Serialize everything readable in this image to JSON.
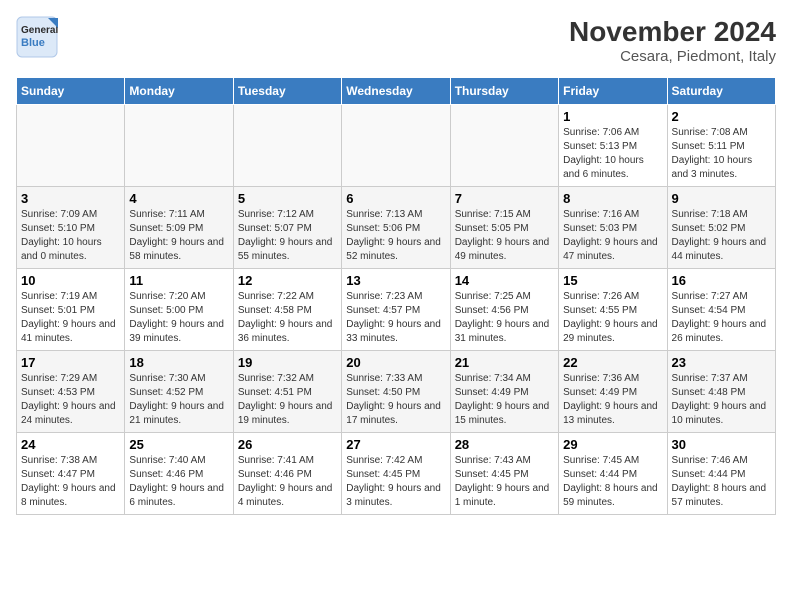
{
  "logo": {
    "line1": "General",
    "line2": "Blue"
  },
  "title": "November 2024",
  "subtitle": "Cesara, Piedmont, Italy",
  "weekdays": [
    "Sunday",
    "Monday",
    "Tuesday",
    "Wednesday",
    "Thursday",
    "Friday",
    "Saturday"
  ],
  "weeks": [
    [
      {
        "day": "",
        "info": ""
      },
      {
        "day": "",
        "info": ""
      },
      {
        "day": "",
        "info": ""
      },
      {
        "day": "",
        "info": ""
      },
      {
        "day": "",
        "info": ""
      },
      {
        "day": "1",
        "info": "Sunrise: 7:06 AM\nSunset: 5:13 PM\nDaylight: 10 hours and 6 minutes."
      },
      {
        "day": "2",
        "info": "Sunrise: 7:08 AM\nSunset: 5:11 PM\nDaylight: 10 hours and 3 minutes."
      }
    ],
    [
      {
        "day": "3",
        "info": "Sunrise: 7:09 AM\nSunset: 5:10 PM\nDaylight: 10 hours and 0 minutes."
      },
      {
        "day": "4",
        "info": "Sunrise: 7:11 AM\nSunset: 5:09 PM\nDaylight: 9 hours and 58 minutes."
      },
      {
        "day": "5",
        "info": "Sunrise: 7:12 AM\nSunset: 5:07 PM\nDaylight: 9 hours and 55 minutes."
      },
      {
        "day": "6",
        "info": "Sunrise: 7:13 AM\nSunset: 5:06 PM\nDaylight: 9 hours and 52 minutes."
      },
      {
        "day": "7",
        "info": "Sunrise: 7:15 AM\nSunset: 5:05 PM\nDaylight: 9 hours and 49 minutes."
      },
      {
        "day": "8",
        "info": "Sunrise: 7:16 AM\nSunset: 5:03 PM\nDaylight: 9 hours and 47 minutes."
      },
      {
        "day": "9",
        "info": "Sunrise: 7:18 AM\nSunset: 5:02 PM\nDaylight: 9 hours and 44 minutes."
      }
    ],
    [
      {
        "day": "10",
        "info": "Sunrise: 7:19 AM\nSunset: 5:01 PM\nDaylight: 9 hours and 41 minutes."
      },
      {
        "day": "11",
        "info": "Sunrise: 7:20 AM\nSunset: 5:00 PM\nDaylight: 9 hours and 39 minutes."
      },
      {
        "day": "12",
        "info": "Sunrise: 7:22 AM\nSunset: 4:58 PM\nDaylight: 9 hours and 36 minutes."
      },
      {
        "day": "13",
        "info": "Sunrise: 7:23 AM\nSunset: 4:57 PM\nDaylight: 9 hours and 33 minutes."
      },
      {
        "day": "14",
        "info": "Sunrise: 7:25 AM\nSunset: 4:56 PM\nDaylight: 9 hours and 31 minutes."
      },
      {
        "day": "15",
        "info": "Sunrise: 7:26 AM\nSunset: 4:55 PM\nDaylight: 9 hours and 29 minutes."
      },
      {
        "day": "16",
        "info": "Sunrise: 7:27 AM\nSunset: 4:54 PM\nDaylight: 9 hours and 26 minutes."
      }
    ],
    [
      {
        "day": "17",
        "info": "Sunrise: 7:29 AM\nSunset: 4:53 PM\nDaylight: 9 hours and 24 minutes."
      },
      {
        "day": "18",
        "info": "Sunrise: 7:30 AM\nSunset: 4:52 PM\nDaylight: 9 hours and 21 minutes."
      },
      {
        "day": "19",
        "info": "Sunrise: 7:32 AM\nSunset: 4:51 PM\nDaylight: 9 hours and 19 minutes."
      },
      {
        "day": "20",
        "info": "Sunrise: 7:33 AM\nSunset: 4:50 PM\nDaylight: 9 hours and 17 minutes."
      },
      {
        "day": "21",
        "info": "Sunrise: 7:34 AM\nSunset: 4:49 PM\nDaylight: 9 hours and 15 minutes."
      },
      {
        "day": "22",
        "info": "Sunrise: 7:36 AM\nSunset: 4:49 PM\nDaylight: 9 hours and 13 minutes."
      },
      {
        "day": "23",
        "info": "Sunrise: 7:37 AM\nSunset: 4:48 PM\nDaylight: 9 hours and 10 minutes."
      }
    ],
    [
      {
        "day": "24",
        "info": "Sunrise: 7:38 AM\nSunset: 4:47 PM\nDaylight: 9 hours and 8 minutes."
      },
      {
        "day": "25",
        "info": "Sunrise: 7:40 AM\nSunset: 4:46 PM\nDaylight: 9 hours and 6 minutes."
      },
      {
        "day": "26",
        "info": "Sunrise: 7:41 AM\nSunset: 4:46 PM\nDaylight: 9 hours and 4 minutes."
      },
      {
        "day": "27",
        "info": "Sunrise: 7:42 AM\nSunset: 4:45 PM\nDaylight: 9 hours and 3 minutes."
      },
      {
        "day": "28",
        "info": "Sunrise: 7:43 AM\nSunset: 4:45 PM\nDaylight: 9 hours and 1 minute."
      },
      {
        "day": "29",
        "info": "Sunrise: 7:45 AM\nSunset: 4:44 PM\nDaylight: 8 hours and 59 minutes."
      },
      {
        "day": "30",
        "info": "Sunrise: 7:46 AM\nSunset: 4:44 PM\nDaylight: 8 hours and 57 minutes."
      }
    ]
  ]
}
